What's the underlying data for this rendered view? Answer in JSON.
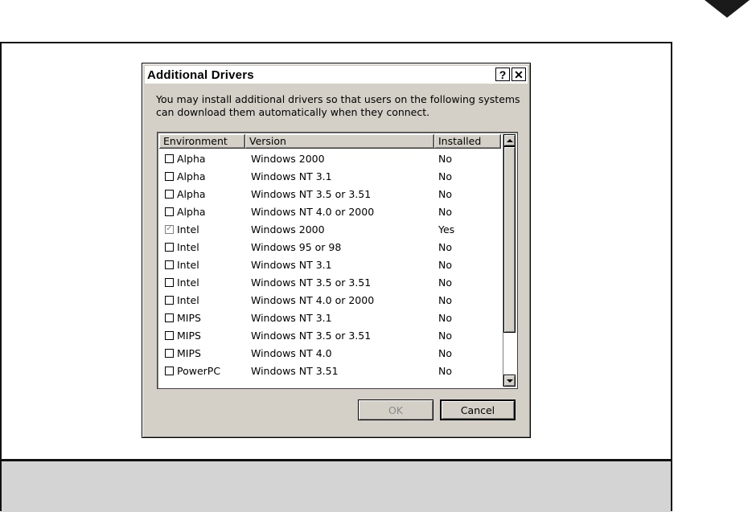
{
  "dialog": {
    "title": "Additional Drivers",
    "help_glyph": "?",
    "close_glyph": "✕",
    "intro": "You may install additional drivers so that users on the following systems can download them automatically when they connect.",
    "columns": [
      "Environment",
      "Version",
      "Installed"
    ],
    "rows": [
      {
        "environment": "Alpha",
        "version": "Windows 2000",
        "installed": "No",
        "checked": false
      },
      {
        "environment": "Alpha",
        "version": "Windows NT 3.1",
        "installed": "No",
        "checked": false
      },
      {
        "environment": "Alpha",
        "version": "Windows NT 3.5 or 3.51",
        "installed": "No",
        "checked": false
      },
      {
        "environment": "Alpha",
        "version": "Windows NT 4.0 or 2000",
        "installed": "No",
        "checked": false
      },
      {
        "environment": "Intel",
        "version": "Windows 2000",
        "installed": "Yes",
        "checked": true
      },
      {
        "environment": "Intel",
        "version": "Windows 95 or 98",
        "installed": "No",
        "checked": false
      },
      {
        "environment": "Intel",
        "version": "Windows NT 3.1",
        "installed": "No",
        "checked": false
      },
      {
        "environment": "Intel",
        "version": "Windows NT 3.5 or 3.51",
        "installed": "No",
        "checked": false
      },
      {
        "environment": "Intel",
        "version": "Windows NT 4.0 or 2000",
        "installed": "No",
        "checked": false
      },
      {
        "environment": "MIPS",
        "version": "Windows NT 3.1",
        "installed": "No",
        "checked": false
      },
      {
        "environment": "MIPS",
        "version": "Windows NT 3.5 or 3.51",
        "installed": "No",
        "checked": false
      },
      {
        "environment": "MIPS",
        "version": "Windows NT 4.0",
        "installed": "No",
        "checked": false
      },
      {
        "environment": "PowerPC",
        "version": "Windows NT 3.51",
        "installed": "No",
        "checked": false
      }
    ],
    "ok_label": "OK",
    "ok_enabled": false,
    "cancel_label": "Cancel"
  }
}
